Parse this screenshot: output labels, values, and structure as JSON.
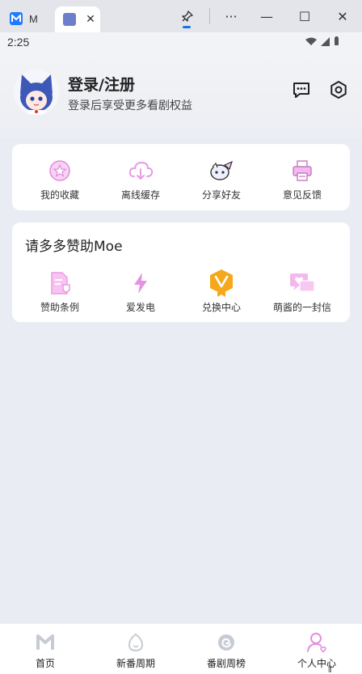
{
  "browser": {
    "tabs": [
      {
        "title": "M",
        "active": false
      },
      {
        "title": "",
        "active": true
      }
    ],
    "close_glyph": "✕",
    "pin_icon": "pin-icon",
    "more_glyph": "···",
    "minimize_glyph": "—",
    "maximize_glyph": "☐",
    "window_close_glyph": "✕",
    "accent": "#1a73e8"
  },
  "status": {
    "time": "2:25"
  },
  "profile": {
    "title": "登录/注册",
    "subtitle": "登录后享受更多看剧权益",
    "message_icon": "message-icon",
    "settings_icon": "gear-icon"
  },
  "quick_actions": [
    {
      "label": "我的收藏",
      "icon": "star-coin-icon"
    },
    {
      "label": "离线缓存",
      "icon": "cloud-download-icon"
    },
    {
      "label": "分享好友",
      "icon": "share-mascot-icon"
    },
    {
      "label": "意见反馈",
      "icon": "printer-icon"
    }
  ],
  "sponsor": {
    "title": "请多多赞助Moe",
    "items": [
      {
        "label": "赞助条例",
        "icon": "document-shield-icon"
      },
      {
        "label": "爱发电",
        "icon": "lightning-icon"
      },
      {
        "label": "兑换中心",
        "icon": "badge-icon"
      },
      {
        "label": "萌酱的一封信",
        "icon": "letter-heart-icon"
      }
    ]
  },
  "bottom_nav": [
    {
      "label": "首页",
      "icon": "home-m-icon",
      "active": false
    },
    {
      "label": "新番周期",
      "icon": "egg-icon",
      "active": false
    },
    {
      "label": "番剧周榜",
      "icon": "swirl-icon",
      "active": false
    },
    {
      "label": "个人中心",
      "icon": "user-heart-icon",
      "active": true
    }
  ],
  "colors": {
    "pink": "#e9a3e4",
    "orange": "#f5a81c",
    "background": "#e9ecf2"
  }
}
